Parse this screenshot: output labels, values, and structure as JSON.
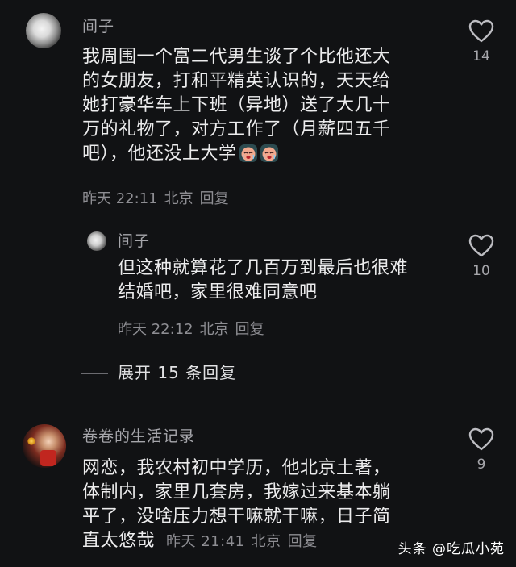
{
  "comments": [
    {
      "username": "间子",
      "lines": [
        "我周围一个富二代男生谈了个比他还大",
        "的女朋友，打和平精英认识的，天天给",
        "她打豪华车上下班（异地）送了大几十",
        "万的礼物了，对方工作了（月薪四五千",
        "吧），他还没上大学"
      ],
      "time": "昨天 22:11",
      "location": "北京",
      "reply_label": "回复",
      "likes": "14",
      "emoji_count": 2
    },
    {
      "username": "间子",
      "lines": [
        "但这种就算花了几百万到最后也很难",
        "结婚吧，家里很难同意吧"
      ],
      "time": "昨天 22:12",
      "location": "北京",
      "reply_label": "回复",
      "likes": "10"
    },
    {
      "username": "卷卷的生活记录",
      "lines": [
        "网恋，我农村初中学历，他北京土著，",
        "体制内，家里几套房，我嫁过来基本躺",
        "平了，没啥压力想干嘛就干嘛，日子简",
        "直太悠哉"
      ],
      "time": "昨天 21:41",
      "location": "北京",
      "reply_label": "回复",
      "likes": "9"
    }
  ],
  "expand_replies": "展开 15 条回复",
  "watermark": "头条 @吃瓜小苑",
  "colors": {
    "background": "#111214",
    "text": "#ececed",
    "secondary": "#8e8e93"
  }
}
